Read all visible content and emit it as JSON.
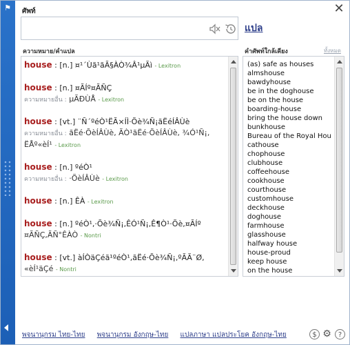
{
  "window": {
    "title": "ศัพท์",
    "close_glyph": "✕"
  },
  "search": {
    "value": "",
    "placeholder": ""
  },
  "translate_link": "แปล",
  "meaning_section": {
    "label": "ความหมาย/คำแปล",
    "alt_label": "ความหมายอื่น :",
    "entries": [
      {
        "word": "house",
        "pos": ": [n.]",
        "text": "¤¹´Ùã¹ãÃ§ÀÒ¾Â¹µÃì",
        "source": "- Lexitron",
        "alt": ""
      },
      {
        "word": "house",
        "pos": ": [n.]",
        "text": "¤ÃÍº¤ÃÑÇ",
        "source": "",
        "alt": "µÃÐÙÅ",
        "alt_source": "- Lexitron"
      },
      {
        "word": "house",
        "pos": ": [vt.]",
        "text": "¨Ñ´ºéÒ¹ËÃ×ÍÌ·Õè¾Ñ¡ãËéÍÂÙè",
        "source": "",
        "alt": "ãËé·ÕèÍÂÙè, ÃÒ¹ãËé·ÕèÍÂÙè, ¾Ó¹Ñ¡,",
        "alt2": "ËÅº«èÍ¹",
        "alt_source": "- Lexitron"
      },
      {
        "word": "house",
        "pos": ": [n.]",
        "text": "ºéÒ¹",
        "source": "",
        "alt": "·ÕèÍÂÙè",
        "alt_source": "- Lexitron"
      },
      {
        "word": "house",
        "pos": ": [n.]",
        "text": "ÊÀ",
        "source": "- Lexitron",
        "alt": ""
      },
      {
        "word": "house",
        "pos": ": [n.]",
        "text": "ºéÒ¹,·Õè¾Ñ¡,ÊÓ¹Ñ¡,Ê¶Ò¹·Õè,¤ÃÍº",
        "source": "",
        "alt": "",
        "line2": "¤ÃÑÇ,ÃÑ°ÊÀÒ",
        "line2_source": "- Nontri"
      },
      {
        "word": "house",
        "pos": ": [vt.]",
        "text": "àÍÒäÇéã¹ºéÒ¹,ãËé·Õè¾Ñ¡,ºÃÃ¨Ø,",
        "source": "",
        "alt": "",
        "line2": "«èÍ¹äÇé",
        "line2_source": "- Nontri"
      }
    ]
  },
  "similar_section": {
    "label": "คำศัพท์ใกล้เคียง",
    "show_all": "ทั้งหมด",
    "items": [
      "(as) safe as houses",
      "almshouse",
      "bawdyhouse",
      "be in the doghouse",
      "be on the house",
      "boarding-house",
      "bring the house down",
      "bunkhouse",
      "Bureau of the Royal Household",
      "cathouse",
      "chophouse",
      "clubhouse",
      "coffeehouse",
      "cookhouse",
      "courthouse",
      "customhouse",
      "deckhouse",
      "doghouse",
      "farmhouse",
      "glasshouse",
      "halfway house",
      "house-proud",
      "keep house",
      "on the house"
    ]
  },
  "footer": {
    "links": [
      "พจนานุกรม ไทย-ไทย",
      "พจนานุกรม อังกฤษ-ไทย",
      "แปลภาษา แปลประโยค อังกฤษ-ไทย"
    ],
    "dollar_glyph": "$",
    "gear_glyph": "⚙",
    "help_glyph": "?"
  },
  "colors": {
    "headword": "#a81f1f",
    "source": "#5a9a4a",
    "link": "#2d3e8a",
    "sidebar": "#2a72c9"
  }
}
